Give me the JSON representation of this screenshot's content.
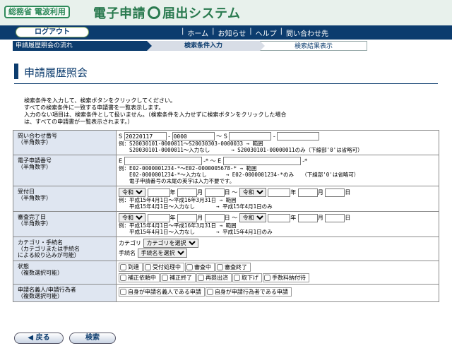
{
  "header": {
    "logo_left": "総務省 電波利用",
    "logo_title_a": "電子申請",
    "logo_title_b": "届出システム"
  },
  "nav": {
    "logout": "ログアウト",
    "links": [
      "ホーム",
      "お知らせ",
      "ヘルプ",
      "問い合わせ先"
    ],
    "separator": "|"
  },
  "steps": [
    "申請履歴照会の流れ",
    "検索条件入力",
    "検索結果表示"
  ],
  "page_title": "申請履歴照会",
  "intro": [
    "検索条件を入力して、検索ボタンをクリックしてください。",
    "すべての検索条件に一致する申請書を一覧表示します。",
    "入力のない項目は、検索条件として扱いません。（検索条件を入力せずに検索ボタンをクリックした場合",
    "は、すべての申請書が一覧表示されます。）"
  ],
  "form": {
    "inquiry": {
      "label1": "問い合わせ番号",
      "label2": "（半角数字）",
      "prefix": "S",
      "from_1": "20220117",
      "from_2": "0000",
      "to_prefix": "S",
      "to_1": "",
      "to_2": "",
      "dash": "-",
      "tilde": "～",
      "ex1": "例：S20030101-0000011～S20030303-0000033 → 範囲",
      "ex2": "　　S20030101-0000011～入力なし　　　　→ S20030101-00000011のみ（下線部'0'は省略可）"
    },
    "app_no": {
      "label1": "電子申請番号",
      "label2": "（半角数字）",
      "prefix": "E",
      "suffix_star": "-*",
      "tilde": "～",
      "to_prefix": "E",
      "ex1": "例：E02-0000001234-*～E02-0000005678-* → 範囲",
      "ex2": "　　E02-0000001234-*～入力なし　　　 → E02-0000001234-*のみ　　（下線部'0'は省略可）",
      "ex3": "　　電子申請番号の末尾の英字は入力不要です。"
    },
    "received": {
      "label1": "受付日",
      "label2": "（半角数字）",
      "era": "令和",
      "era_to": "令和",
      "year": "年",
      "month": "月",
      "day": "日",
      "tilde": "～",
      "ex1": "例：平成15年4月1日～平成16年3月31日 → 範囲",
      "ex2": "　　平成15年4月1日～入力なし　　　　→ 平成15年4月1日のみ"
    },
    "completed": {
      "label1": "審査完了日",
      "label2": "（半角数字）",
      "era": "令和",
      "era_to": "令和",
      "year": "年",
      "month": "月",
      "day": "日",
      "tilde": "～",
      "ex1": "例：平成15年4月1日～平成16年3月31日 → 範囲",
      "ex2": "　　平成15年4月1日～入力なし　　　　→ 平成15年4月1日のみ"
    },
    "category": {
      "label1": "カテゴリ・手続名",
      "label2": "（カテゴリまたは手続名",
      "label3": "による絞り込みが可能）",
      "cat_label": "カテゴリ",
      "cat_value": "カテゴリを選択",
      "proc_label": "手続名",
      "proc_value": "手続名を選択"
    },
    "status": {
      "label1": "状態",
      "label2": "（複数選択可能）",
      "row1": [
        "到達",
        "受付処理中",
        "審査中",
        "審査終了"
      ],
      "row2": [
        "補正依頼中",
        "補正終了",
        "再提出済",
        "取下げ",
        "手数料納付待"
      ]
    },
    "applicant": {
      "label1": "申請名義人/申請行為者",
      "label2": "（複数選択可能）",
      "options": [
        "自身が申請名義人である申請",
        "自身が申請行為者である申請"
      ]
    }
  },
  "buttons": {
    "back": "◀ 戻る",
    "search": "検索"
  }
}
